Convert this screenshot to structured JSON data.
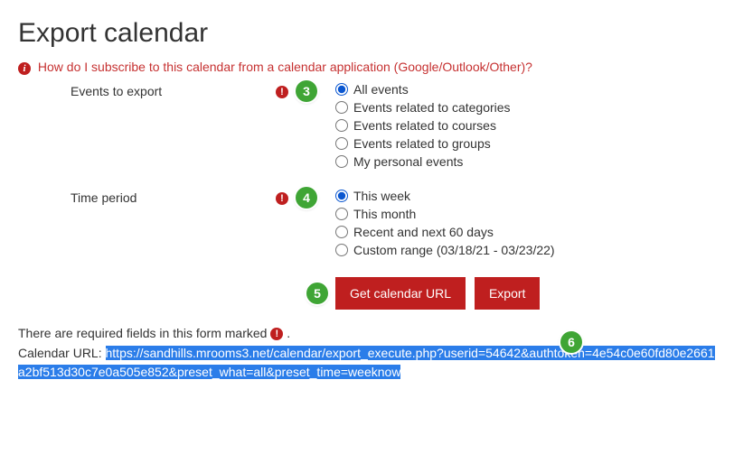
{
  "page": {
    "title": "Export calendar",
    "help_link": "How do I subscribe to this calendar from a calendar application (Google/Outlook/Other)?"
  },
  "form": {
    "events": {
      "label": "Events to export",
      "options": [
        {
          "label": "All events",
          "checked": true
        },
        {
          "label": "Events related to categories",
          "checked": false
        },
        {
          "label": "Events related to courses",
          "checked": false
        },
        {
          "label": "Events related to groups",
          "checked": false
        },
        {
          "label": "My personal events",
          "checked": false
        }
      ]
    },
    "time": {
      "label": "Time period",
      "options": [
        {
          "label": "This week",
          "checked": true
        },
        {
          "label": "This month",
          "checked": false
        },
        {
          "label": "Recent and next 60 days",
          "checked": false
        },
        {
          "label": "Custom range (03/18/21 - 03/23/22)",
          "checked": false
        }
      ]
    },
    "buttons": {
      "get_url": "Get calendar URL",
      "export": "Export"
    },
    "required_note_prefix": "There are required fields in this form marked ",
    "required_note_suffix": " .",
    "url_label": "Calendar URL: ",
    "url_value": "https://sandhills.mrooms3.net/calendar/export_execute.php?userid=54642&authtoken=4e54c0e60fd80e2661a2bf513d30c7e0a505e852&preset_what=all&preset_time=weeknow"
  },
  "annotations": {
    "a3": "3",
    "a4": "4",
    "a5": "5",
    "a6": "6"
  }
}
